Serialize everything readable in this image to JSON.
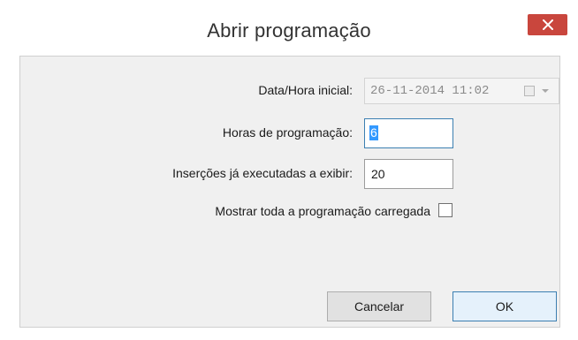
{
  "window": {
    "title": "Abrir programação",
    "close_icon": "close-icon",
    "close_color": "#c9463d"
  },
  "form": {
    "start_datetime": {
      "label": "Data/Hora inicial:",
      "value": "26-11-2014 11:02",
      "enabled": false,
      "calendar_checkbox_icon": "checkbox-icon",
      "dropdown_icon": "chevron-down-icon"
    },
    "programming_hours": {
      "label": "Horas de programação:",
      "value": "6",
      "focused": true,
      "text_selected": true
    },
    "executed_insertions": {
      "label": "Inserções já executadas a exibir:",
      "value": "20"
    },
    "show_all": {
      "label": "Mostrar toda a programação carregada",
      "checked": false
    }
  },
  "buttons": {
    "cancel_label": "Cancelar",
    "ok_label": "OK",
    "default": "ok"
  }
}
